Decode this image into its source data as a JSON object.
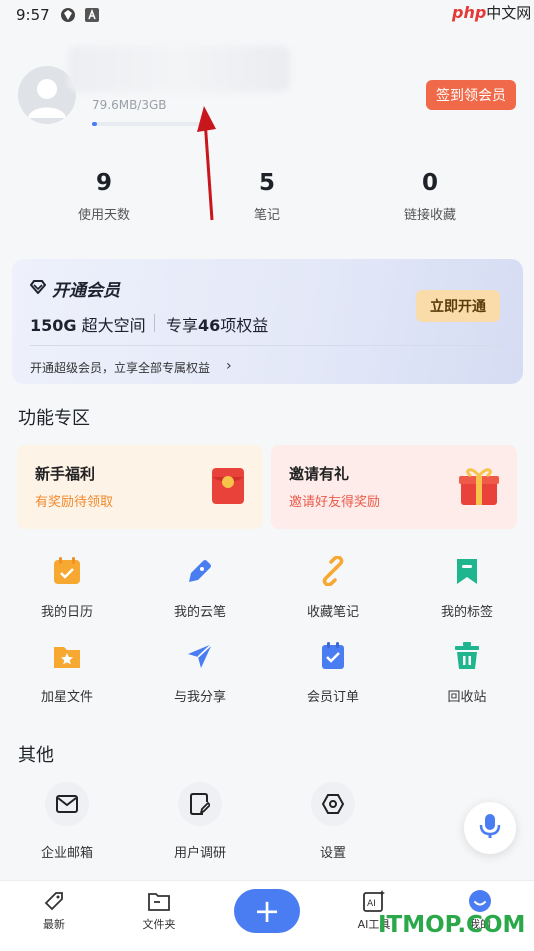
{
  "status_bar": {
    "time": "9:57",
    "php_logo": "php",
    "php_logo_cn": "中文网"
  },
  "profile": {
    "storage_text": "79.6MB/3GB",
    "storage_fraction": 0.027,
    "checkin_label": "签到领会员"
  },
  "stats": [
    {
      "value": "9",
      "label": "使用天数"
    },
    {
      "value": "5",
      "label": "笔记"
    },
    {
      "value": "0",
      "label": "链接收藏"
    }
  ],
  "vip": {
    "title": "开通会员",
    "space_bold": "150G",
    "space_rest": " 超大空间",
    "benefits_pre": "专享",
    "benefits_bold": "46",
    "benefits_post": "项权益",
    "footer": "开通超级会员，立享全部专属权益",
    "button": "立即开通"
  },
  "features": {
    "title": "功能专区",
    "promos": [
      {
        "title": "新手福利",
        "subtitle": "有奖励待领取",
        "color": "#f08a2c",
        "bg": "#fdf3e7"
      },
      {
        "title": "邀请有礼",
        "subtitle": "邀请好友得奖励",
        "color": "#ea5c4b",
        "bg": "#fdecea"
      }
    ],
    "grid": [
      {
        "label": "我的日历",
        "icon": "calendar-icon"
      },
      {
        "label": "我的云笔",
        "icon": "pen-icon"
      },
      {
        "label": "收藏笔记",
        "icon": "link-icon"
      },
      {
        "label": "我的标签",
        "icon": "bookmark-icon"
      },
      {
        "label": "加星文件",
        "icon": "star-folder-icon"
      },
      {
        "label": "与我分享",
        "icon": "send-icon"
      },
      {
        "label": "会员订单",
        "icon": "order-icon"
      },
      {
        "label": "回收站",
        "icon": "trash-icon"
      }
    ]
  },
  "other": {
    "title": "其他",
    "items": [
      {
        "label": "企业邮箱",
        "icon": "mail-icon"
      },
      {
        "label": "用户调研",
        "icon": "survey-icon"
      },
      {
        "label": "设置",
        "icon": "settings-icon"
      }
    ]
  },
  "bottom_nav": {
    "items": [
      {
        "label": "最新",
        "icon": "recent-icon"
      },
      {
        "label": "文件夹",
        "icon": "folder-icon"
      },
      {
        "label": "AI工具",
        "icon": "ai-icon"
      },
      {
        "label": "我的",
        "icon": "profile-icon"
      }
    ],
    "add_label": "+"
  },
  "watermark": "ITMOP.COM",
  "colors": {
    "accent": "#4a7df2",
    "checkin": "#f06a4a",
    "vip_button": "#f9dca9"
  }
}
